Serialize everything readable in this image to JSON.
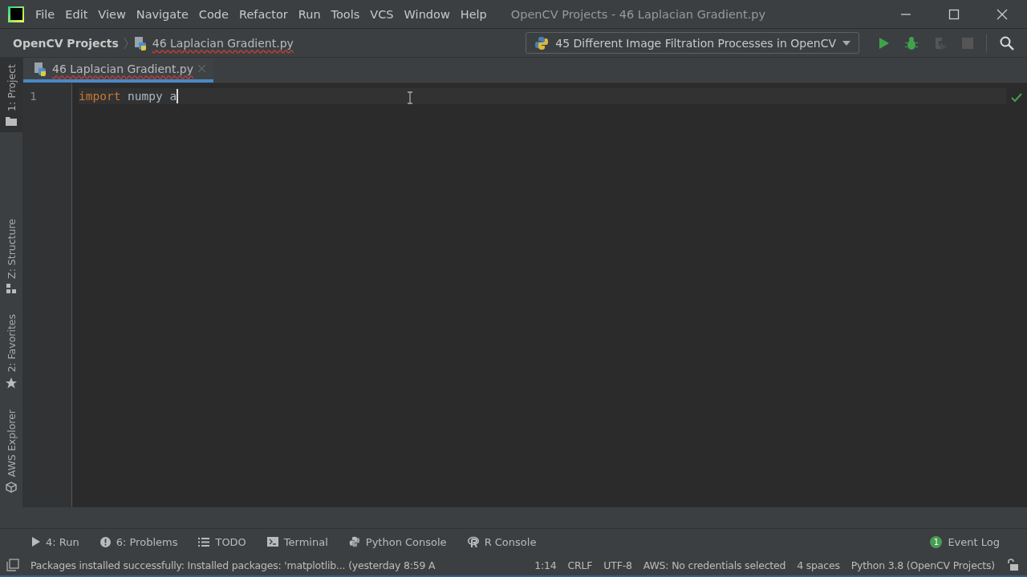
{
  "window": {
    "title": "OpenCV Projects - 46 Laplacian Gradient.py"
  },
  "menu": [
    "File",
    "Edit",
    "View",
    "Navigate",
    "Code",
    "Refactor",
    "Run",
    "Tools",
    "VCS",
    "Window",
    "Help"
  ],
  "breadcrumbs": [
    {
      "label": "OpenCV Projects",
      "kind": "project"
    },
    {
      "label": "46 Laplacian Gradient.py",
      "kind": "file"
    }
  ],
  "run_configuration": {
    "label": "45 Different Image Filtration Processes in OpenCV"
  },
  "toolbar": [
    {
      "kind": "run",
      "disabled": false
    },
    {
      "kind": "debug",
      "disabled": false
    },
    {
      "kind": "coverage",
      "disabled": true
    },
    {
      "kind": "stop",
      "disabled": true
    }
  ],
  "editor_tabs": [
    {
      "label": "46 Laplacian Gradient.py",
      "selected": true
    }
  ],
  "side_tabs_top": [
    {
      "label": "1: Project",
      "kind": "project",
      "selected": true
    }
  ],
  "side_tabs_bottom": [
    {
      "label": "Z: Structure",
      "kind": "structure",
      "selected": false
    },
    {
      "label": "2: Favorites",
      "kind": "favorites",
      "selected": false
    },
    {
      "label": "AWS Explorer",
      "kind": "aws",
      "selected": false
    }
  ],
  "code_lines": [
    {
      "number": "1",
      "tokens": [
        {
          "text": "import",
          "kind": "keyword"
        },
        {
          "text": " numpy a",
          "kind": "plain"
        }
      ]
    }
  ],
  "tool_windows": [
    {
      "label": "4: Run",
      "kind": "run"
    },
    {
      "label": "6: Problems",
      "kind": "problems"
    },
    {
      "label": "TODO",
      "kind": "todo"
    },
    {
      "label": "Terminal",
      "kind": "terminal"
    },
    {
      "label": "Python Console",
      "kind": "python"
    },
    {
      "label": "R Console",
      "kind": "r"
    }
  ],
  "event_log": {
    "label": "Event Log",
    "count": "1"
  },
  "status_bar": {
    "message": "Packages installed successfully: Installed packages: 'matplotlib... (yesterday 8:59 A",
    "items": [
      "1:14",
      "CRLF",
      "UTF-8",
      "AWS: No credentials selected",
      "4 spaces",
      "Python 3.8 (OpenCV Projects)"
    ]
  }
}
